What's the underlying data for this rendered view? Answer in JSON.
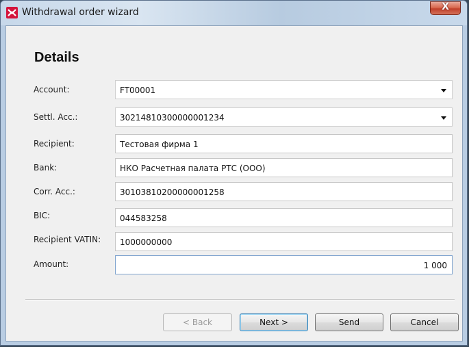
{
  "window": {
    "title": "Withdrawal order wizard",
    "close_glyph": "X",
    "app_icon": "moex-logo-icon"
  },
  "page": {
    "heading": "Details"
  },
  "form": {
    "account": {
      "label": "Account:",
      "value": "FT00001"
    },
    "settl_acc": {
      "label": "Settl. Acc.:",
      "value": "30214810300000001234"
    },
    "recipient": {
      "label": "Recipient:",
      "value": "Тестовая фирма 1"
    },
    "bank": {
      "label": "Bank:",
      "value": "НКО Расчетная палата РТС (ООО)"
    },
    "corr_acc": {
      "label": "Corr. Acc.:",
      "value": "30103810200000001258"
    },
    "bic": {
      "label": "BIC:",
      "value": "044583258"
    },
    "recipient_vatin": {
      "label": "Recipient VATIN:",
      "value": "1000000000"
    },
    "amount": {
      "label": "Amount:",
      "value": "1 000"
    }
  },
  "buttons": {
    "back": "< Back",
    "next": "Next >",
    "send": "Send",
    "cancel": "Cancel"
  }
}
